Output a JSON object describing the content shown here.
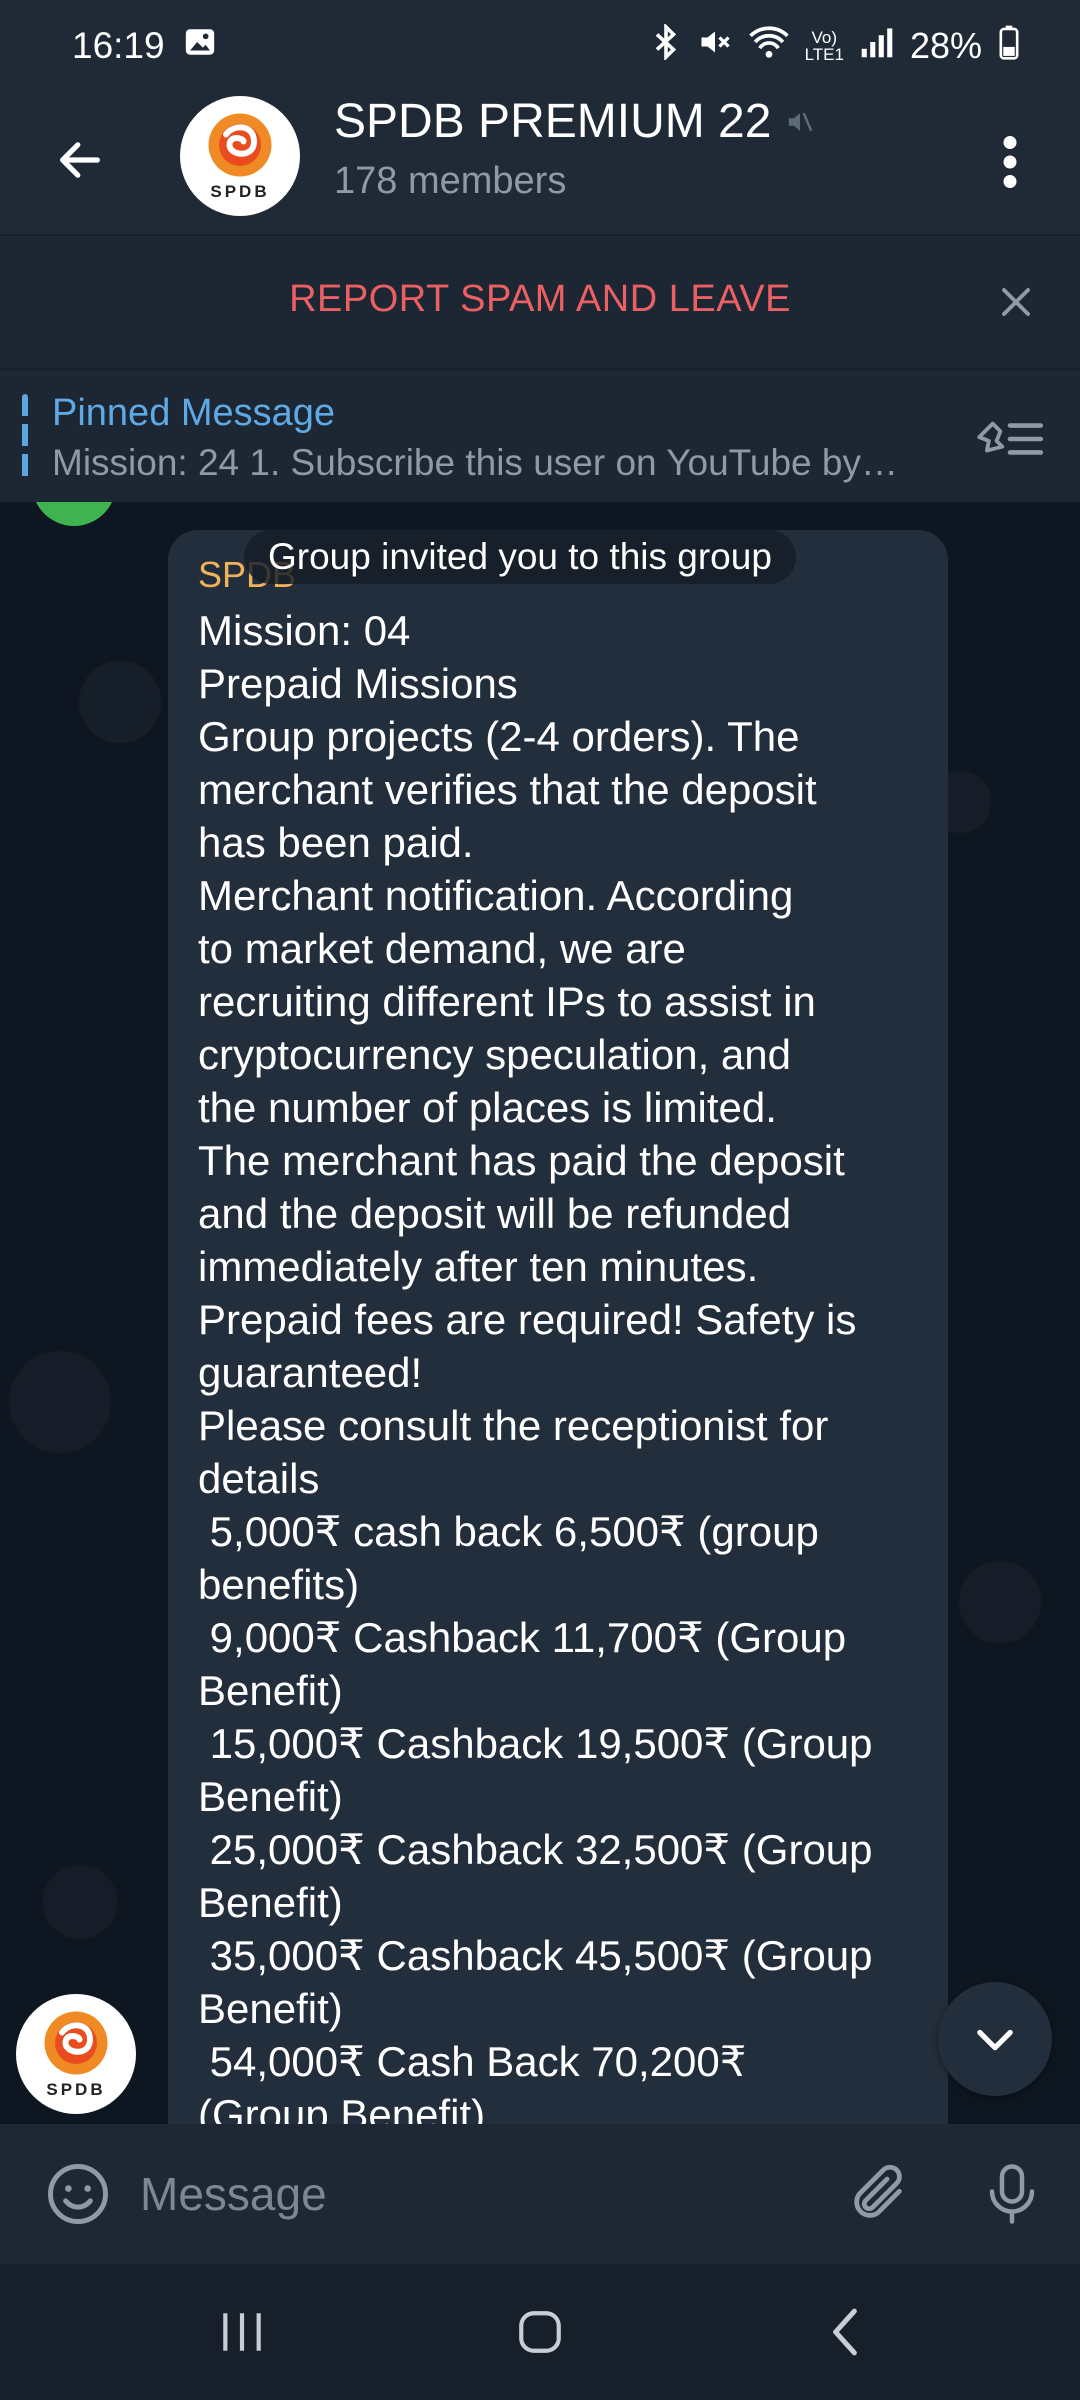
{
  "status_bar": {
    "time": "16:19",
    "battery": "28%",
    "icons": [
      "gallery-icon",
      "bluetooth-icon",
      "mute-icon",
      "wifi-icon",
      "volte-icon",
      "signal-icon",
      "battery-icon"
    ],
    "volte_text": "Vo)\nLTE1"
  },
  "header": {
    "title": "SPDB PREMIUM 22",
    "subtitle": "178 members",
    "avatar_text": "SPDB"
  },
  "spam_bar": {
    "label": "REPORT SPAM AND LEAVE"
  },
  "pinned": {
    "title": "Pinned Message",
    "text": "Mission: 24  1. Subscribe this user on YouTube by…"
  },
  "service_message": "Group invited you to this group",
  "message": {
    "sender": "SPDB",
    "lines": [
      "Mission: 04",
      "Prepaid Missions",
      "Group projects (2-4 orders). The",
      "merchant verifies that the deposit",
      "has been paid.",
      "Merchant notification. According",
      "to market demand, we are",
      "recruiting different IPs to assist in",
      "cryptocurrency speculation, and",
      "the number of places is limited.",
      "The merchant has paid the deposit",
      "and the deposit will be refunded",
      "immediately after ten minutes.",
      "Prepaid fees are required! Safety is",
      "guaranteed!",
      "Please consult the receptionist for",
      "details",
      " 5,000₹ cash back 6,500₹ (group",
      "benefits)",
      " 9,000₹ Cashback 11,700₹ (Group",
      "Benefit)",
      " 15,000₹ Cashback 19,500₹ (Group",
      "Benefit)",
      " 25,000₹ Cashback 32,500₹ (Group",
      "Benefit)",
      " 35,000₹ Cashback 45,500₹ (Group",
      "Benefit)",
      " 54,000₹ Cash Back 70,200₹",
      "(Group Benefit)"
    ]
  },
  "input": {
    "placeholder": "Message"
  },
  "colors": {
    "header_bg": "#202a36",
    "chat_bg": "#0e1621",
    "bubble_bg": "#232e3c",
    "spam_red": "#ec5f63",
    "link_blue": "#5ea9e6",
    "sender_orange": "#f1b35a"
  }
}
